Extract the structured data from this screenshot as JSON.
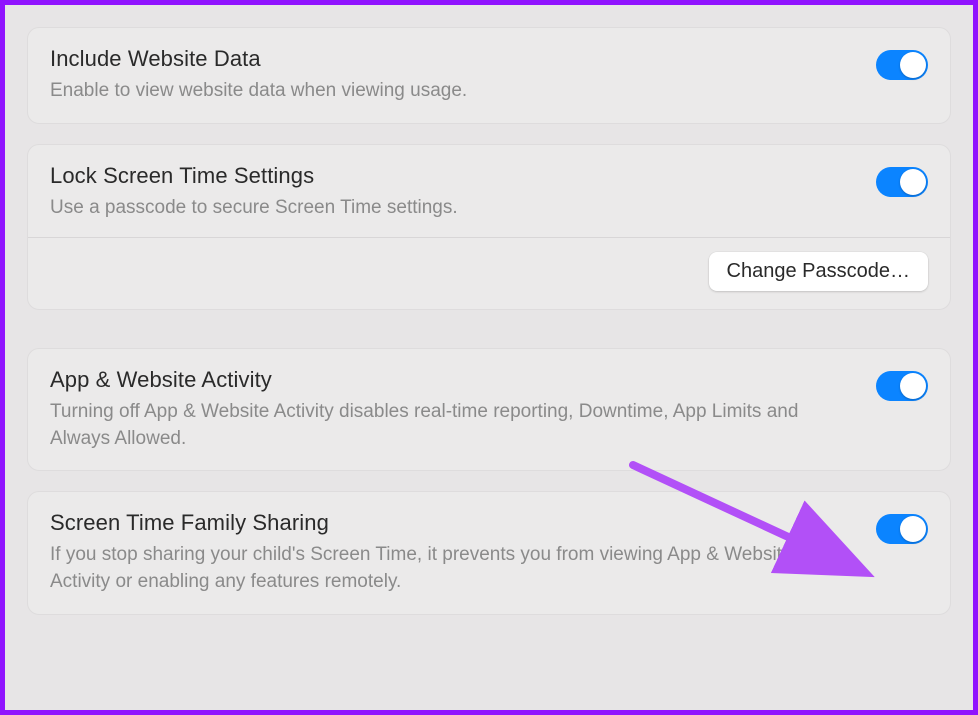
{
  "sections": {
    "includeWebsiteData": {
      "title": "Include Website Data",
      "subtitle": "Enable to view website data when viewing usage."
    },
    "lockScreenTime": {
      "title": "Lock Screen Time Settings",
      "subtitle": "Use a passcode to secure Screen Time settings.",
      "changePasscodeLabel": "Change Passcode…"
    },
    "appWebsiteActivity": {
      "title": "App & Website Activity",
      "subtitle": "Turning off App & Website Activity disables real-time reporting, Downtime, App Limits and Always Allowed."
    },
    "familySharing": {
      "title": "Screen Time Family Sharing",
      "subtitle": "If you stop sharing your child's Screen Time, it prevents you from viewing App & Website Activity or enabling any features remotely."
    }
  },
  "annotation": {
    "arrowColor": "#b250f7"
  }
}
